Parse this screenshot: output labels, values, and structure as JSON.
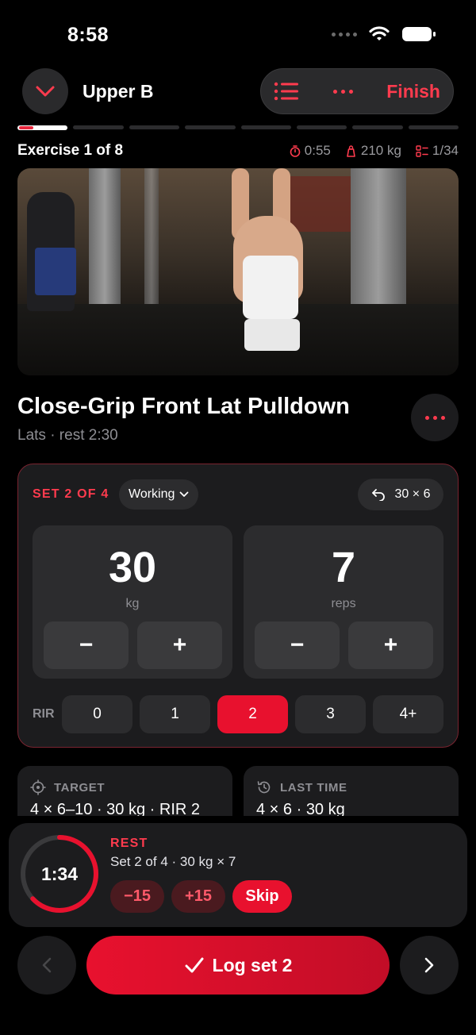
{
  "status_bar": {
    "time": "8:58"
  },
  "header": {
    "workout_name": "Upper B",
    "finish_label": "Finish"
  },
  "progress": {
    "current_exercise": 1,
    "total_exercises": 8
  },
  "exercise_meta": {
    "counter": "Exercise 1 of 8",
    "elapsed": "0:55",
    "volume": "210 kg",
    "sets_done": "1/34"
  },
  "exercise": {
    "title": "Close-Grip Front Lat Pulldown",
    "subtitle": "Lats · rest 2:30"
  },
  "set": {
    "label": "SET 2 OF 4",
    "type": "Working",
    "previous": "30 × 6",
    "weight": {
      "value": "30",
      "unit": "kg",
      "minus": "−",
      "plus": "+"
    },
    "reps": {
      "value": "7",
      "unit": "reps",
      "minus": "−",
      "plus": "+"
    },
    "rir_label": "RIR",
    "rir_options": [
      "0",
      "1",
      "2",
      "3",
      "4+"
    ],
    "rir_selected": "2"
  },
  "info_cards": {
    "target": {
      "label": "TARGET",
      "text": "4 × 6–10 · 30 kg · RIR 2"
    },
    "last_time": {
      "label": "LAST TIME",
      "text": "4 × 6 · 30 kg"
    }
  },
  "rest": {
    "time": "1:34",
    "title": "REST",
    "subtitle": "Set 2 of 4 · 30 kg × 7",
    "minus_label": "−15",
    "plus_label": "+15",
    "skip_label": "Skip",
    "remaining_fraction": 0.63
  },
  "bottom": {
    "log_label": "Log set 2"
  },
  "colors": {
    "accent": "#e8112e",
    "accent_text": "#ff3b4e",
    "card": "#1c1c1e"
  }
}
